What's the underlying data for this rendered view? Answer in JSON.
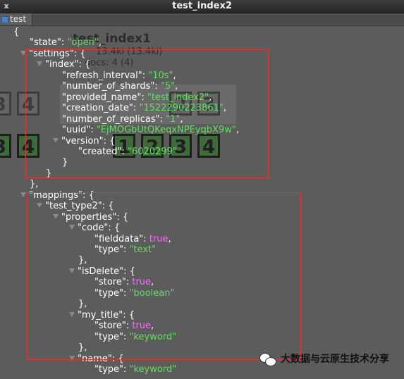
{
  "window": {
    "title": "test_index2",
    "close_glyph": "x"
  },
  "tab": {
    "label": "test"
  },
  "background": {
    "index_name": "test_index1",
    "size": "13.4ki (13.4ki)",
    "docs": "docs: 4 (4)",
    "replica_shards": [
      "3",
      "4",
      "2",
      "3"
    ],
    "primary_shards": [
      "3",
      "4",
      "1",
      "2",
      "3",
      "4"
    ]
  },
  "json_lines": [
    {
      "indent": 0,
      "tri": false,
      "parts": [
        [
          "punc",
          "{"
        ]
      ]
    },
    {
      "indent": 1,
      "tri": false,
      "parts": [
        [
          "key",
          "\"state\""
        ],
        [
          "punc",
          ": "
        ],
        [
          "str",
          "\"open\""
        ],
        [
          "punc",
          ","
        ]
      ]
    },
    {
      "indent": 1,
      "tri": true,
      "parts": [
        [
          "key",
          "\"settings\""
        ],
        [
          "punc",
          ": {"
        ]
      ]
    },
    {
      "indent": 2,
      "tri": true,
      "parts": [
        [
          "key",
          "\"index\""
        ],
        [
          "punc",
          ": {"
        ]
      ]
    },
    {
      "indent": 3,
      "tri": false,
      "parts": [
        [
          "key",
          "\"refresh_interval\""
        ],
        [
          "punc",
          ": "
        ],
        [
          "str",
          "\"10s\""
        ],
        [
          "punc",
          ","
        ]
      ]
    },
    {
      "indent": 3,
      "tri": false,
      "parts": [
        [
          "key",
          "\"number_of_shards\""
        ],
        [
          "punc",
          ": "
        ],
        [
          "str",
          "\"5\""
        ],
        [
          "punc",
          ","
        ]
      ]
    },
    {
      "indent": 3,
      "tri": false,
      "parts": [
        [
          "key",
          "\"provided_name\""
        ],
        [
          "punc",
          ": "
        ],
        [
          "str",
          "\"test_index2\""
        ],
        [
          "punc",
          ","
        ]
      ]
    },
    {
      "indent": 3,
      "tri": false,
      "parts": [
        [
          "key",
          "\"creation_date\""
        ],
        [
          "punc",
          ": "
        ],
        [
          "str",
          "\"1522290223861\""
        ],
        [
          "punc",
          ","
        ]
      ]
    },
    {
      "indent": 3,
      "tri": false,
      "parts": [
        [
          "key",
          "\"number_of_replicas\""
        ],
        [
          "punc",
          ": "
        ],
        [
          "str",
          "\"1\""
        ],
        [
          "punc",
          ","
        ]
      ]
    },
    {
      "indent": 3,
      "tri": false,
      "parts": [
        [
          "key",
          "\"uuid\""
        ],
        [
          "punc",
          ": "
        ],
        [
          "str",
          "\"EjMOGbUtQKeqxNPEyqbX9w\""
        ],
        [
          "punc",
          ","
        ]
      ]
    },
    {
      "indent": 3,
      "tri": true,
      "parts": [
        [
          "key",
          "\"version\""
        ],
        [
          "punc",
          ": {"
        ]
      ]
    },
    {
      "indent": 4,
      "tri": false,
      "parts": [
        [
          "key",
          "\"created\""
        ],
        [
          "punc",
          ": "
        ],
        [
          "str",
          "\"6020299\""
        ]
      ]
    },
    {
      "indent": 3,
      "tri": false,
      "parts": [
        [
          "punc",
          "}"
        ]
      ]
    },
    {
      "indent": 2,
      "tri": false,
      "parts": [
        [
          "punc",
          "}"
        ]
      ]
    },
    {
      "indent": 1,
      "tri": false,
      "parts": [
        [
          "punc",
          "},"
        ]
      ]
    },
    {
      "indent": 1,
      "tri": true,
      "parts": [
        [
          "key",
          "\"mappings\""
        ],
        [
          "punc",
          ": {"
        ]
      ]
    },
    {
      "indent": 2,
      "tri": true,
      "parts": [
        [
          "key",
          "\"test_type2\""
        ],
        [
          "punc",
          ": {"
        ]
      ]
    },
    {
      "indent": 3,
      "tri": true,
      "parts": [
        [
          "key",
          "\"properties\""
        ],
        [
          "punc",
          ": {"
        ]
      ]
    },
    {
      "indent": 4,
      "tri": true,
      "parts": [
        [
          "key",
          "\"code\""
        ],
        [
          "punc",
          ": {"
        ]
      ]
    },
    {
      "indent": 5,
      "tri": false,
      "parts": [
        [
          "key",
          "\"fielddata\""
        ],
        [
          "punc",
          ": "
        ],
        [
          "bool",
          "true"
        ],
        [
          "punc",
          ","
        ]
      ]
    },
    {
      "indent": 5,
      "tri": false,
      "parts": [
        [
          "key",
          "\"type\""
        ],
        [
          "punc",
          ": "
        ],
        [
          "str",
          "\"text\""
        ]
      ]
    },
    {
      "indent": 4,
      "tri": false,
      "parts": [
        [
          "punc",
          "},"
        ]
      ]
    },
    {
      "indent": 4,
      "tri": true,
      "parts": [
        [
          "key",
          "\"isDelete\""
        ],
        [
          "punc",
          ": {"
        ]
      ]
    },
    {
      "indent": 5,
      "tri": false,
      "parts": [
        [
          "key",
          "\"store\""
        ],
        [
          "punc",
          ": "
        ],
        [
          "bool",
          "true"
        ],
        [
          "punc",
          ","
        ]
      ]
    },
    {
      "indent": 5,
      "tri": false,
      "parts": [
        [
          "key",
          "\"type\""
        ],
        [
          "punc",
          ": "
        ],
        [
          "str",
          "\"boolean\""
        ]
      ]
    },
    {
      "indent": 4,
      "tri": false,
      "parts": [
        [
          "punc",
          "},"
        ]
      ]
    },
    {
      "indent": 4,
      "tri": true,
      "parts": [
        [
          "key",
          "\"my_title\""
        ],
        [
          "punc",
          ": {"
        ]
      ]
    },
    {
      "indent": 5,
      "tri": false,
      "parts": [
        [
          "key",
          "\"store\""
        ],
        [
          "punc",
          ": "
        ],
        [
          "bool",
          "true"
        ],
        [
          "punc",
          ","
        ]
      ]
    },
    {
      "indent": 5,
      "tri": false,
      "parts": [
        [
          "key",
          "\"type\""
        ],
        [
          "punc",
          ": "
        ],
        [
          "str",
          "\"keyword\""
        ]
      ]
    },
    {
      "indent": 4,
      "tri": false,
      "parts": [
        [
          "punc",
          "},"
        ]
      ]
    },
    {
      "indent": 4,
      "tri": true,
      "parts": [
        [
          "key",
          "\"name\""
        ],
        [
          "punc",
          ": {"
        ]
      ]
    },
    {
      "indent": 5,
      "tri": false,
      "parts": [
        [
          "key",
          "\"type\""
        ],
        [
          "punc",
          ": "
        ],
        [
          "str",
          "\"keyword\""
        ]
      ]
    }
  ],
  "watermark": {
    "text": "大数据与云原生技术分享"
  }
}
